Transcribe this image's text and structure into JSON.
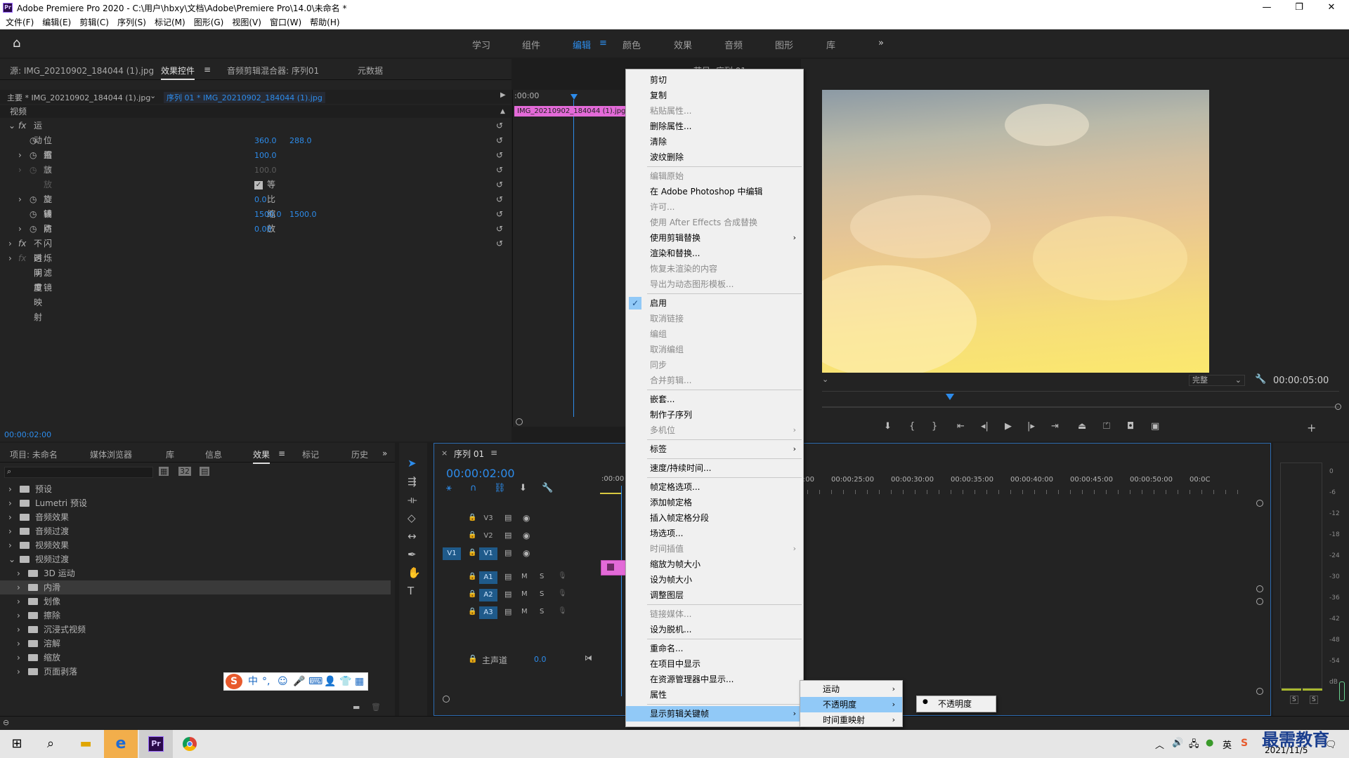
{
  "window": {
    "title": "Adobe Premiere Pro 2020 - C:\\用户\\hbxy\\文档\\Adobe\\Premiere Pro\\14.0\\未命名 *",
    "minimize": "—",
    "maximize": "❐",
    "close": "✕"
  },
  "menubar": [
    "文件(F)",
    "编辑(E)",
    "剪辑(C)",
    "序列(S)",
    "标记(M)",
    "图形(G)",
    "视图(V)",
    "窗口(W)",
    "帮助(H)"
  ],
  "workspaces": {
    "items": [
      "学习",
      "组件",
      "编辑",
      "颜色",
      "效果",
      "音频",
      "图形",
      "库"
    ],
    "active": "编辑",
    "more": "»"
  },
  "effect_controls": {
    "tabs": [
      "源: IMG_20210902_184044 (1).jpg",
      "效果控件",
      "音频剪辑混合器: 序列01",
      "元数据"
    ],
    "master_label": "主要 * IMG_20210902_184044 (1).jpg",
    "sequence_label": "序列 01 * IMG_20210902_184044 (1).jpg",
    "video_label": "视频",
    "motion": "运动",
    "props": {
      "position": "位置",
      "position_x": "360.0",
      "position_y": "288.0",
      "scale": "缩放",
      "scale_val": "100.0",
      "scale_width": "缩放宽度",
      "scale_width_val": "100.0",
      "uniform_scale": "等比缩放",
      "rotation": "旋转",
      "rotation_val": "0.0",
      "anchor": "锚点",
      "anchor_x": "1500.0",
      "anchor_y": "1500.0",
      "antiflicker": "防闪烁滤镜",
      "antiflicker_val": "0.00"
    },
    "opacity": "不透明度",
    "time_remap": "时间重映射",
    "timecode": "00:00:02:00",
    "mini_timeline_start": ":00:00",
    "clip_label": "IMG_20210902_184044 (1).jpg"
  },
  "program": {
    "partial_title": "节目: 序列 01",
    "quality": "完整",
    "timecode": "00:00:05:00"
  },
  "effects_panel": {
    "tabs": [
      "项目: 未命名",
      "媒体浏览器",
      "库",
      "信息",
      "效果",
      "标记",
      "历史"
    ],
    "active_tab": "效果",
    "items": [
      {
        "label": "预设",
        "level": 0,
        "open": false
      },
      {
        "label": "Lumetri 预设",
        "level": 0,
        "open": false
      },
      {
        "label": "音频效果",
        "level": 0,
        "open": false
      },
      {
        "label": "音频过渡",
        "level": 0,
        "open": false
      },
      {
        "label": "视频效果",
        "level": 0,
        "open": false
      },
      {
        "label": "视频过渡",
        "level": 0,
        "open": true
      },
      {
        "label": "3D 运动",
        "level": 1,
        "open": false
      },
      {
        "label": "内滑",
        "level": 1,
        "open": false,
        "selected": true
      },
      {
        "label": "划像",
        "level": 1,
        "open": false
      },
      {
        "label": "擦除",
        "level": 1,
        "open": false
      },
      {
        "label": "沉浸式视频",
        "level": 1,
        "open": false
      },
      {
        "label": "溶解",
        "level": 1,
        "open": false
      },
      {
        "label": "缩放",
        "level": 1,
        "open": false
      },
      {
        "label": "页面剥落",
        "level": 1,
        "open": false
      }
    ],
    "ime_label": "中"
  },
  "timeline": {
    "tab": "序列 01",
    "timecode": "00:00:02:00",
    "ruler_start": ":00:00",
    "ruler_marks": [
      "00:00:20:00",
      "00:00:25:00",
      "00:00:30:00",
      "00:00:35:00",
      "00:00:40:00",
      "00:00:45:00",
      "00:00:50:00",
      "00:0C"
    ],
    "video_tracks": [
      "V3",
      "V2",
      "V1"
    ],
    "audio_tracks": [
      "A1",
      "A2",
      "A3"
    ],
    "source_patch_v": "V1",
    "mute": "M",
    "solo": "S",
    "master": "主声道",
    "master_val": "0.0"
  },
  "vu_meter": {
    "labels": [
      "0",
      "-6",
      "-12",
      "-18",
      "-24",
      "-30",
      "-36",
      "-42",
      "-48",
      "-54",
      "dB"
    ],
    "solo": "S"
  },
  "context_menu": {
    "items": [
      {
        "label": "剪切",
        "disabled": false
      },
      {
        "label": "复制",
        "disabled": false
      },
      {
        "label": "粘贴属性...",
        "disabled": true
      },
      {
        "label": "删除属性...",
        "disabled": false
      },
      {
        "label": "清除",
        "disabled": false
      },
      {
        "label": "波纹删除",
        "disabled": false,
        "sep_after": true
      },
      {
        "label": "编辑原始",
        "disabled": true
      },
      {
        "label": "在 Adobe Photoshop 中编辑",
        "disabled": false
      },
      {
        "label": "许可...",
        "disabled": true
      },
      {
        "label": "使用 After Effects 合成替换",
        "disabled": true
      },
      {
        "label": "使用剪辑替换",
        "disabled": false,
        "submenu": true
      },
      {
        "label": "渲染和替换...",
        "disabled": false
      },
      {
        "label": "恢复未渲染的内容",
        "disabled": true
      },
      {
        "label": "导出为动态图形模板...",
        "disabled": true,
        "sep_after": true
      },
      {
        "label": "启用",
        "disabled": false,
        "checked": true
      },
      {
        "label": "取消链接",
        "disabled": true
      },
      {
        "label": "编组",
        "disabled": true
      },
      {
        "label": "取消编组",
        "disabled": true
      },
      {
        "label": "同步",
        "disabled": true
      },
      {
        "label": "合并剪辑...",
        "disabled": true,
        "sep_after": true
      },
      {
        "label": "嵌套...",
        "disabled": false
      },
      {
        "label": "制作子序列",
        "disabled": false
      },
      {
        "label": "多机位",
        "disabled": true,
        "submenu": true,
        "sep_after": true
      },
      {
        "label": "标签",
        "disabled": false,
        "submenu": true,
        "sep_after": true
      },
      {
        "label": "速度/持续时间...",
        "disabled": false,
        "sep_after": true
      },
      {
        "label": "帧定格选项...",
        "disabled": false
      },
      {
        "label": "添加帧定格",
        "disabled": false
      },
      {
        "label": "插入帧定格分段",
        "disabled": false
      },
      {
        "label": "场选项...",
        "disabled": false
      },
      {
        "label": "时间插值",
        "disabled": true,
        "submenu": true
      },
      {
        "label": "缩放为帧大小",
        "disabled": false
      },
      {
        "label": "设为帧大小",
        "disabled": false
      },
      {
        "label": "调整图层",
        "disabled": false,
        "sep_after": true
      },
      {
        "label": "链接媒体...",
        "disabled": true
      },
      {
        "label": "设为脱机...",
        "disabled": false,
        "sep_after": true
      },
      {
        "label": "重命名...",
        "disabled": false
      },
      {
        "label": "在项目中显示",
        "disabled": false
      },
      {
        "label": "在资源管理器中显示...",
        "disabled": false
      },
      {
        "label": "属性",
        "disabled": false,
        "sep_after": true
      },
      {
        "label": "显示剪辑关键帧",
        "disabled": false,
        "submenu": true,
        "highlighted": true
      }
    ],
    "check_mark": "✓"
  },
  "submenu1": {
    "items": [
      "运动",
      "不透明度",
      "时间重映射"
    ],
    "highlighted": "不透明度"
  },
  "submenu2": {
    "items": [
      "不透明度"
    ],
    "bullet": "●"
  },
  "taskbar": {
    "date": "2021/11/5",
    "time": "",
    "watermark": "最需教育"
  },
  "colors": {
    "accent": "#2d8ceb",
    "clip_pink": "#e36ad8",
    "menu_highlight": "#91c9f7"
  }
}
